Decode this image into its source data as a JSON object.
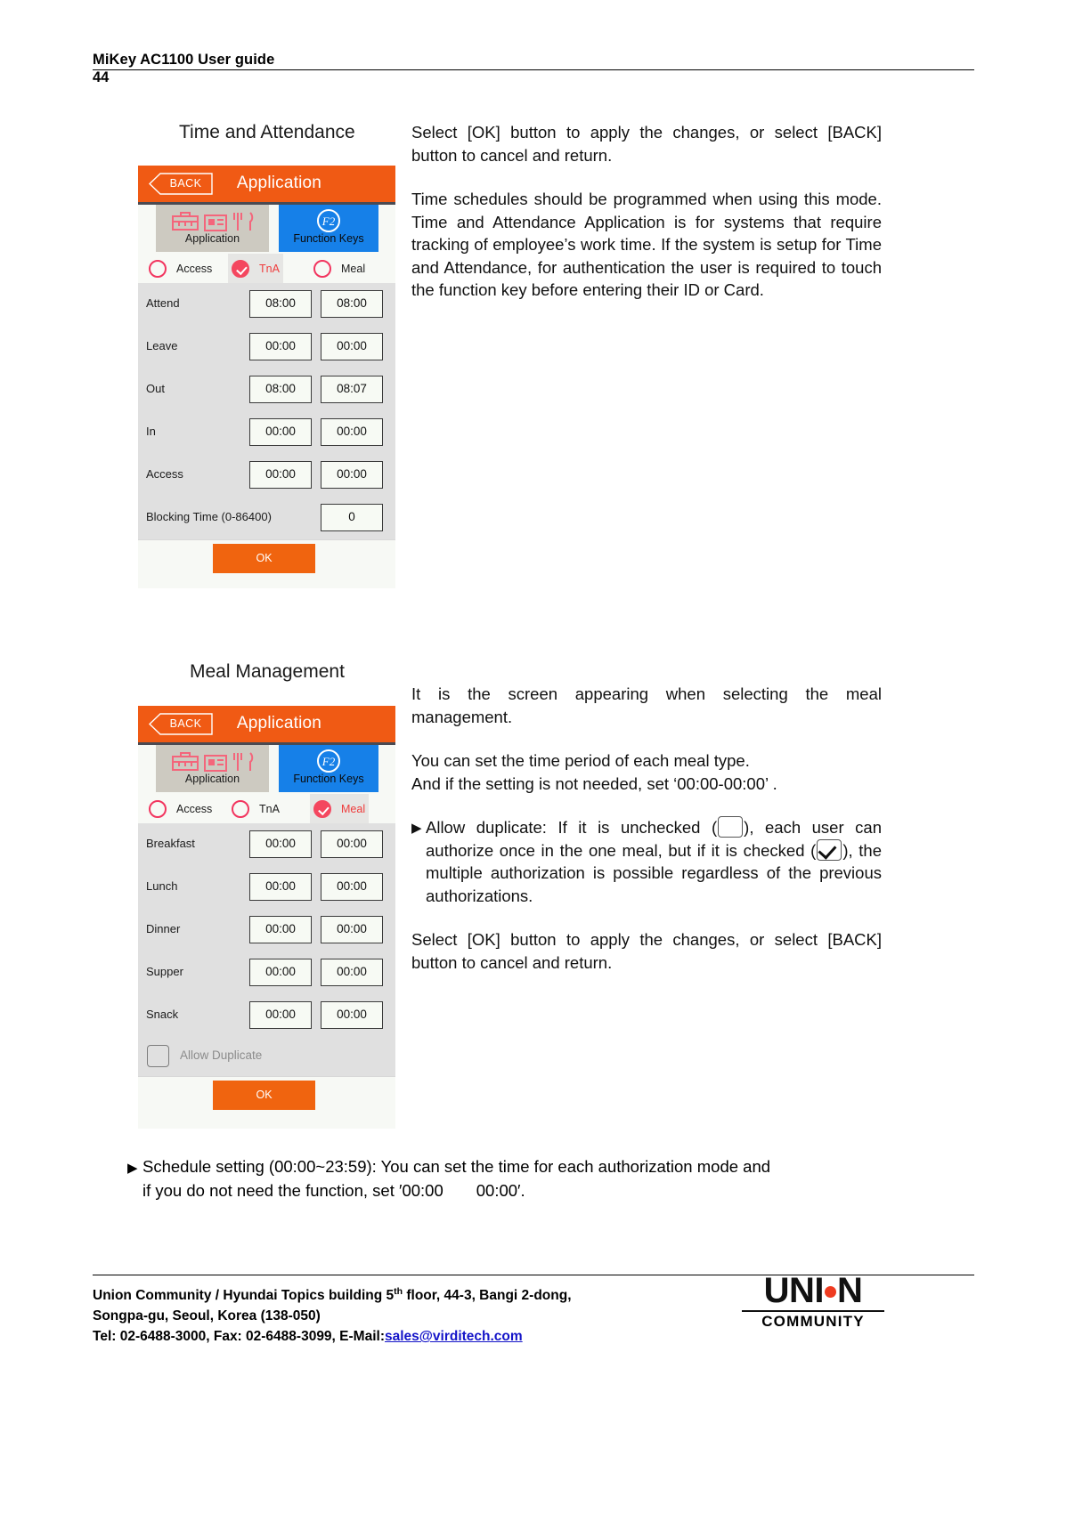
{
  "header": {
    "title": "MiKey AC1100 User guide",
    "page_number": "44"
  },
  "sections": {
    "tna": {
      "heading": "Time and Attendance",
      "paragraphs": [
        "Select [OK] button to apply the changes, or select [BACK] button to cancel and return.",
        "Time schedules should be programmed when using this mode. Time and Attendance Application is for systems that require tracking of employee’s work time. If the system is setup for Time and Attendance, for authentication the user is required to touch the function key before entering their ID or Card."
      ],
      "screen": {
        "back_label": "BACK",
        "title": "Application",
        "tab_app_label": "Application",
        "tab_fn_label": "Function Keys",
        "tab_fn_key": "F2",
        "modes": [
          {
            "label": "Access",
            "selected": false
          },
          {
            "label": "TnA",
            "selected": true
          },
          {
            "label": "Meal",
            "selected": false
          }
        ],
        "rows": [
          {
            "label": "Attend",
            "start": "08:00",
            "end": "08:00"
          },
          {
            "label": "Leave",
            "start": "00:00",
            "end": "00:00"
          },
          {
            "label": "Out",
            "start": "08:00",
            "end": "08:07"
          },
          {
            "label": "In",
            "start": "00:00",
            "end": "00:00"
          },
          {
            "label": "Access",
            "start": "00:00",
            "end": "00:00"
          }
        ],
        "blocking": {
          "label": "Blocking Time (0-86400)",
          "value": "0"
        },
        "ok_label": "OK"
      }
    },
    "meal": {
      "heading": "Meal Management",
      "paragraphs": [
        "It is the screen appearing when selecting the meal management.",
        "You can set the time period of each meal type.",
        "And if the setting is not needed, set  ‘00:00-00:00’ .",
        "Select [OK] button to apply the changes, or select [BACK] button to cancel and return."
      ],
      "bullet": {
        "marker": "▶",
        "part1": "Allow duplicate: If it is unchecked (",
        "part2": "), each user can authorize once in the one meal, but if it is checked (",
        "part3": "), the multiple authorization is possible regardless of the previous authorizations."
      },
      "screen": {
        "back_label": "BACK",
        "title": "Application",
        "tab_app_label": "Application",
        "tab_fn_label": "Function Keys",
        "tab_fn_key": "F2",
        "modes": [
          {
            "label": "Access",
            "selected": false
          },
          {
            "label": "TnA",
            "selected": false
          },
          {
            "label": "Meal",
            "selected": true
          }
        ],
        "rows": [
          {
            "label": "Breakfast",
            "start": "00:00",
            "end": "00:00"
          },
          {
            "label": "Lunch",
            "start": "00:00",
            "end": "00:00"
          },
          {
            "label": "Dinner",
            "start": "00:00",
            "end": "00:00"
          },
          {
            "label": "Supper",
            "start": "00:00",
            "end": "00:00"
          },
          {
            "label": "Snack",
            "start": "00:00",
            "end": "00:00"
          }
        ],
        "allow_duplicate": {
          "label": "Allow Duplicate",
          "checked": false
        },
        "ok_label": "OK"
      }
    }
  },
  "bottom_note": {
    "marker": "▶",
    "line1": "Schedule setting (00:00~23:59): You can set the time for each authorization mode and",
    "line2": "if you do not need the function, set ′00:00  00:00′."
  },
  "footer": {
    "line1_a": "Union Community / Hyundai Topics building 5",
    "line1_sup": "th",
    "line1_b": " floor, 44-3, Bangi 2-dong,",
    "line2": "Songpa-gu, Seoul, Korea (138-050)",
    "line3_a": "Tel: 02-6488-3000, Fax: 02-6488-3099, E-Mail:",
    "line3_link": "sales@virditech.com",
    "logo_text": "UNI N",
    "logo_sub": "COMMUNITY"
  },
  "colors": {
    "orange": "#f05a14",
    "blue": "#1680e8",
    "red": "#f4475f",
    "link": "#1414c8"
  }
}
